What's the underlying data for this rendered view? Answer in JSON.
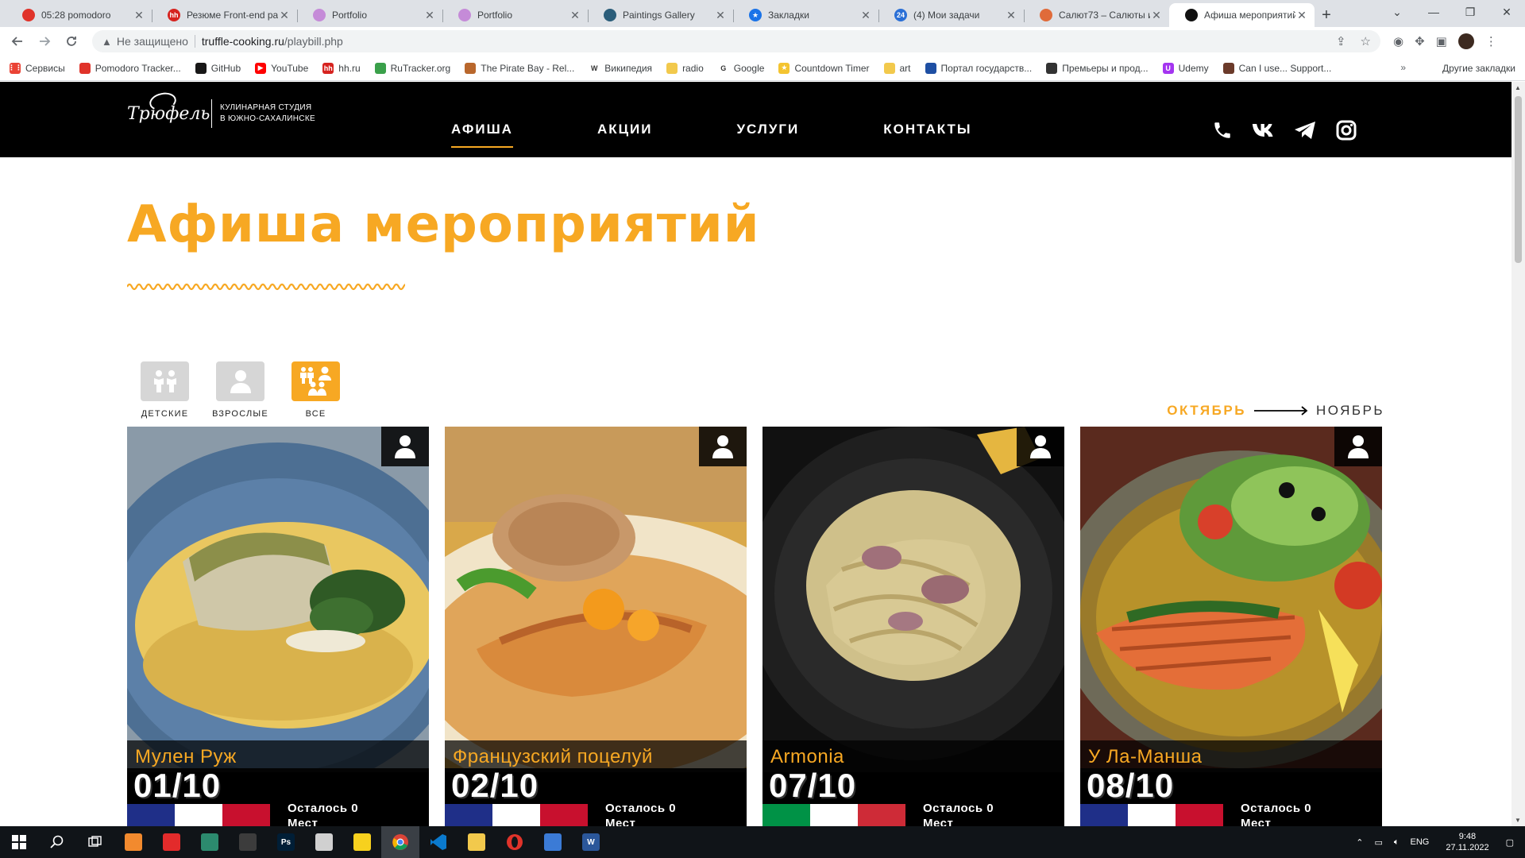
{
  "browser": {
    "tabs": [
      {
        "title": "05:28 pomodoro",
        "fav_color": "#e0332a",
        "fav_glyph": "",
        "active": false
      },
      {
        "title": "Резюме Front-end ра",
        "fav_color": "#d6231f",
        "fav_glyph": "hh",
        "active": false
      },
      {
        "title": "Portfolio",
        "fav_color": "#c58bd8",
        "fav_glyph": "",
        "active": false
      },
      {
        "title": "Portfolio",
        "fav_color": "#c58bd8",
        "fav_glyph": "",
        "active": false
      },
      {
        "title": "Paintings Gallery",
        "fav_color": "#2b5d7a",
        "fav_glyph": "",
        "active": false
      },
      {
        "title": "Закладки",
        "fav_color": "#1a73e8",
        "fav_glyph": "★",
        "active": false
      },
      {
        "title": "(4) Мои задачи",
        "fav_color": "#2a6fd6",
        "fav_glyph": "24",
        "active": false
      },
      {
        "title": "Салют73 – Салюты и",
        "fav_color": "#e06b3a",
        "fav_glyph": "",
        "active": false
      },
      {
        "title": "Афиша мероприятий",
        "fav_color": "#111111",
        "fav_glyph": "",
        "active": true
      }
    ],
    "new_tab": "+",
    "window_controls": {
      "collapse": "⌄",
      "minimize": "—",
      "restore": "❐",
      "close": "✕"
    },
    "address": {
      "security_label": "Не защищено",
      "host": "truffle-cooking.ru",
      "path": "/playbill.php"
    },
    "bookmarks": [
      {
        "label": "Сервисы",
        "color": "#ea4335",
        "glyph": "⋮⋮"
      },
      {
        "label": "Pomodoro Tracker...",
        "color": "#e0332a",
        "glyph": ""
      },
      {
        "label": "GitHub",
        "color": "#181717",
        "glyph": ""
      },
      {
        "label": "YouTube",
        "color": "#ff0000",
        "glyph": "▶"
      },
      {
        "label": "hh.ru",
        "color": "#d6231f",
        "glyph": "hh"
      },
      {
        "label": "RuTracker.org",
        "color": "#3aa04a",
        "glyph": ""
      },
      {
        "label": "The Pirate Bay - Rel...",
        "color": "#b9672c",
        "glyph": ""
      },
      {
        "label": "Википедия",
        "color": "#ffffff",
        "glyph": "W"
      },
      {
        "label": "radio",
        "color": "#f2c94c",
        "glyph": ""
      },
      {
        "label": "Google",
        "color": "#ffffff",
        "glyph": "G"
      },
      {
        "label": "Countdown Timer",
        "color": "#f4c430",
        "glyph": "★"
      },
      {
        "label": "art",
        "color": "#f2c94c",
        "glyph": ""
      },
      {
        "label": "Портал государств...",
        "color": "#1e4fa3",
        "glyph": ""
      },
      {
        "label": "Премьеры и прод...",
        "color": "#333333",
        "glyph": ""
      },
      {
        "label": "Udemy",
        "color": "#a435f0",
        "glyph": "U"
      },
      {
        "label": "Can I use... Support...",
        "color": "#6b3a2a",
        "glyph": ""
      }
    ],
    "bookmarks_more": "»",
    "other_bookmarks": "Другие закладки"
  },
  "site": {
    "logo_script": "Трюфель",
    "logo_studio_line1": "КУЛИНАРНАЯ СТУДИЯ",
    "logo_studio_line2": "В ЮЖНО-САХАЛИНСКЕ",
    "nav": [
      {
        "label": "АФИША",
        "active": true
      },
      {
        "label": "АКЦИИ",
        "active": false
      },
      {
        "label": "УСЛУГИ",
        "active": false
      },
      {
        "label": "КОНТАКТЫ",
        "active": false
      }
    ],
    "social": [
      "phone-icon",
      "vk-icon",
      "telegram-icon",
      "instagram-icon"
    ],
    "title": "Афиша мероприятий",
    "filters": [
      {
        "label": "ДЕТСКИЕ",
        "icon": "kids-icon",
        "active": false
      },
      {
        "label": "ВЗРОСЛЫЕ",
        "icon": "adult-icon",
        "active": false
      },
      {
        "label": "ВСЕ",
        "icon": "all-icon",
        "active": true
      }
    ],
    "months": {
      "current": "ОКТЯБРЬ",
      "next": "НОЯБРЬ"
    },
    "accent_color": "#f7a823",
    "events": [
      {
        "name": "Мулен Руж",
        "date": "01/10",
        "seats_line1": "Осталось 0",
        "seats_line2": "Мест",
        "flag": [
          "#1f2f88",
          "#ffffff",
          "#c8102e"
        ]
      },
      {
        "name": "Французский поцелуй",
        "date": "02/10",
        "seats_line1": "Осталось 0",
        "seats_line2": "Мест",
        "flag": [
          "#1f2f88",
          "#ffffff",
          "#c8102e"
        ]
      },
      {
        "name": "Armonia",
        "date": "07/10",
        "seats_line1": "Осталось 0",
        "seats_line2": "Мест",
        "flag": [
          "#009246",
          "#ffffff",
          "#ce2b37"
        ]
      },
      {
        "name": "У Ла-Манша",
        "date": "08/10",
        "seats_line1": "Осталось 0",
        "seats_line2": "Мест",
        "flag": [
          "#1f2f88",
          "#ffffff",
          "#c8102e"
        ]
      }
    ]
  },
  "taskbar": {
    "apps": [
      "windows-start-icon",
      "search-icon",
      "task-view-icon",
      "xampp-icon",
      "media-player-icon",
      "vpn-icon",
      "app-icon",
      "photoshop-icon",
      "paint-icon",
      "potplayer-icon",
      "chrome-icon",
      "vscode-icon",
      "explorer-icon",
      "opera-icon",
      "app2-icon",
      "word-icon"
    ],
    "lang": "ENG",
    "time": "9:48",
    "date": "27.11.2022"
  }
}
